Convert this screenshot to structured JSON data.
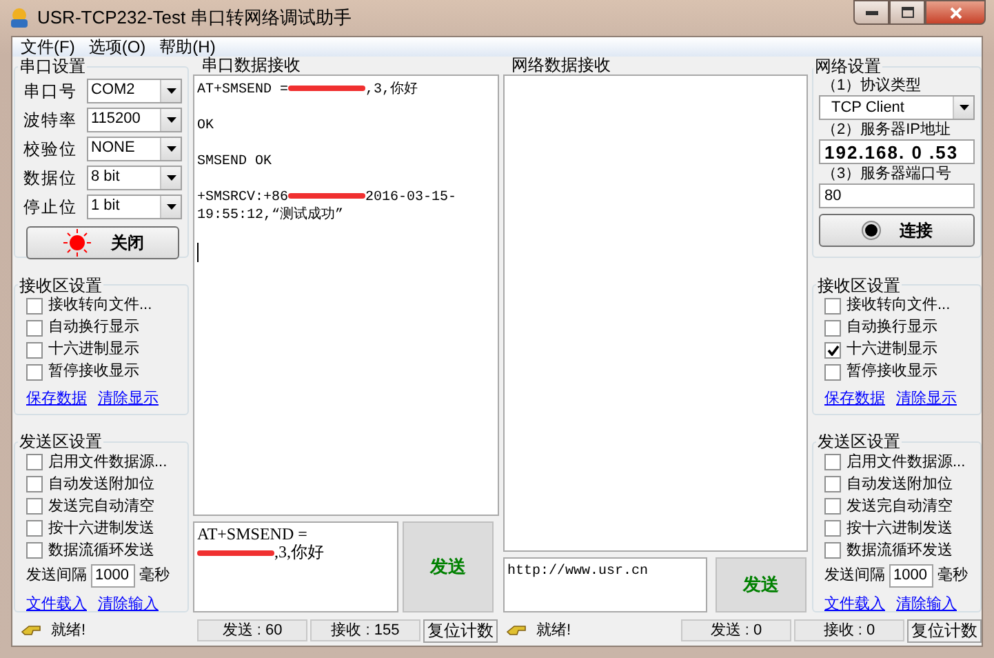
{
  "window": {
    "title": "USR-TCP232-Test 串口转网络调试助手"
  },
  "menu": [
    "文件(F)",
    "选项(O)",
    "帮助(H)"
  ],
  "serial_settings": {
    "title": "串口设置",
    "fields": [
      {
        "label": "串口号",
        "value": "COM2"
      },
      {
        "label": "波特率",
        "value": "115200"
      },
      {
        "label": "校验位",
        "value": "NONE"
      },
      {
        "label": "数据位",
        "value": "8 bit"
      },
      {
        "label": "停止位",
        "value": "1 bit"
      }
    ],
    "button": {
      "label": "关闭",
      "on": true
    }
  },
  "serial_receive_settings": {
    "title": "接收区设置",
    "options": [
      {
        "label": "接收转向文件...",
        "checked": false
      },
      {
        "label": "自动换行显示",
        "checked": false
      },
      {
        "label": "十六进制显示",
        "checked": false
      },
      {
        "label": "暂停接收显示",
        "checked": false
      }
    ],
    "links": [
      "保存数据",
      "清除显示"
    ]
  },
  "serial_send_settings": {
    "title": "发送区设置",
    "options": [
      {
        "label": "启用文件数据源...",
        "checked": false
      },
      {
        "label": "自动发送附加位",
        "checked": false
      },
      {
        "label": "发送完自动清空",
        "checked": false
      },
      {
        "label": "按十六进制发送",
        "checked": false
      },
      {
        "label": "数据流循环发送",
        "checked": false
      }
    ],
    "interval": {
      "label": "发送间隔",
      "value": "1000",
      "unit": "毫秒"
    },
    "links": [
      "文件载入",
      "清除输入"
    ]
  },
  "serial_receive": {
    "title": "串口数据接收",
    "paragraphs": [
      {
        "lines": [
          [
            {
              "kind": "text",
              "text": "AT+SMSEND ="
            },
            {
              "kind": "redaction"
            },
            {
              "kind": "text",
              "text": ",3,你好"
            }
          ]
        ]
      },
      {
        "lines": [
          [
            {
              "kind": "text",
              "text": "OK"
            }
          ]
        ]
      },
      {
        "lines": [
          [
            {
              "kind": "text",
              "text": "SMSEND OK"
            }
          ]
        ]
      },
      {
        "lines": [
          [
            {
              "kind": "text",
              "text": "+SMSRCV:+86"
            },
            {
              "kind": "redaction"
            },
            {
              "kind": "text",
              "text": "2016-03-15-"
            }
          ],
          [
            {
              "kind": "text",
              "text": "19:55:12,“测试成功”"
            }
          ]
        ]
      }
    ],
    "cursor": true
  },
  "serial_send": {
    "lines": [
      [
        {
          "kind": "text",
          "text": "AT+SMSEND ="
        }
      ],
      [
        {
          "kind": "redaction"
        },
        {
          "kind": "text",
          "text": ",3,你好"
        }
      ]
    ],
    "button": "发送"
  },
  "network_receive": {
    "title": "网络数据接收"
  },
  "network_send": {
    "value": "http://www.usr.cn",
    "button": "发送"
  },
  "network_settings": {
    "title": "网络设置",
    "protocol_label": "（1）协议类型",
    "protocol": "TCP Client",
    "ip_label": "（2）服务器IP地址",
    "ip": "192.168. 0 .53",
    "port_label": "（3）服务器端口号",
    "port": "80",
    "button": {
      "label": "连接",
      "on": false
    }
  },
  "network_receive_settings": {
    "title": "接收区设置",
    "options": [
      {
        "label": "接收转向文件...",
        "checked": false
      },
      {
        "label": "自动换行显示",
        "checked": false
      },
      {
        "label": "十六进制显示",
        "checked": true
      },
      {
        "label": "暂停接收显示",
        "checked": false
      }
    ],
    "links": [
      "保存数据",
      "清除显示"
    ]
  },
  "network_send_settings": {
    "title": "发送区设置",
    "options": [
      {
        "label": "启用文件数据源...",
        "checked": false
      },
      {
        "label": "自动发送附加位",
        "checked": false
      },
      {
        "label": "发送完自动清空",
        "checked": false
      },
      {
        "label": "按十六进制发送",
        "checked": false
      },
      {
        "label": "数据流循环发送",
        "checked": false
      }
    ],
    "interval": {
      "label": "发送间隔",
      "value": "1000",
      "unit": "毫秒"
    },
    "links": [
      "文件载入",
      "清除输入"
    ]
  },
  "status_bars": [
    {
      "status": "就绪!",
      "sent": "发送 : 60",
      "received": "接收 : 155",
      "button": "复位计数"
    },
    {
      "status": "就绪!",
      "sent": "发送 : 0",
      "received": "接收 : 0",
      "button": "复位计数"
    }
  ]
}
